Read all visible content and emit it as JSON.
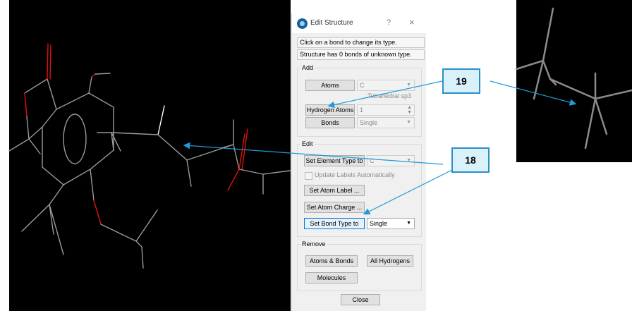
{
  "dialog": {
    "title": "Edit Structure",
    "help_glyph": "?",
    "close_glyph": "×",
    "message_1": "Click on a bond to change its type.",
    "message_2": "Structure has 0 bonds of unknown type.",
    "add": {
      "title": "Add",
      "atoms_button": "Atoms",
      "atom_element": "C",
      "geometry": "Tetrahedral sp3",
      "hydrogen_button": "Hydrogen Atoms",
      "hydrogen_count": "1",
      "bonds_button": "Bonds",
      "bond_type": "Single"
    },
    "edit": {
      "title": "Edit",
      "set_element_button": "Set Element Type to",
      "element_value": "C",
      "update_labels": "Update Labels Automatically",
      "set_label_button": "Set Atom Label ...",
      "set_charge_button": "Set Atom Charge ...",
      "set_bond_button": "Set Bond Type to",
      "bond_value": "Single"
    },
    "remove": {
      "title": "Remove",
      "atoms_bonds_button": "Atoms & Bonds",
      "all_hydrogens_button": "All Hydrogens",
      "molecules_button": "Molecules"
    },
    "close_button": "Close"
  },
  "callouts": [
    {
      "label": "19"
    },
    {
      "label": "18"
    }
  ],
  "colors": {
    "bond_gray": "#a0a0a0",
    "bond_white": "#ffffff",
    "oxygen_red": "#e01010",
    "callout_fill": "#d9f1fb",
    "callout_border": "#2b8fc8",
    "arrow_blue": "#1f9bd7"
  }
}
